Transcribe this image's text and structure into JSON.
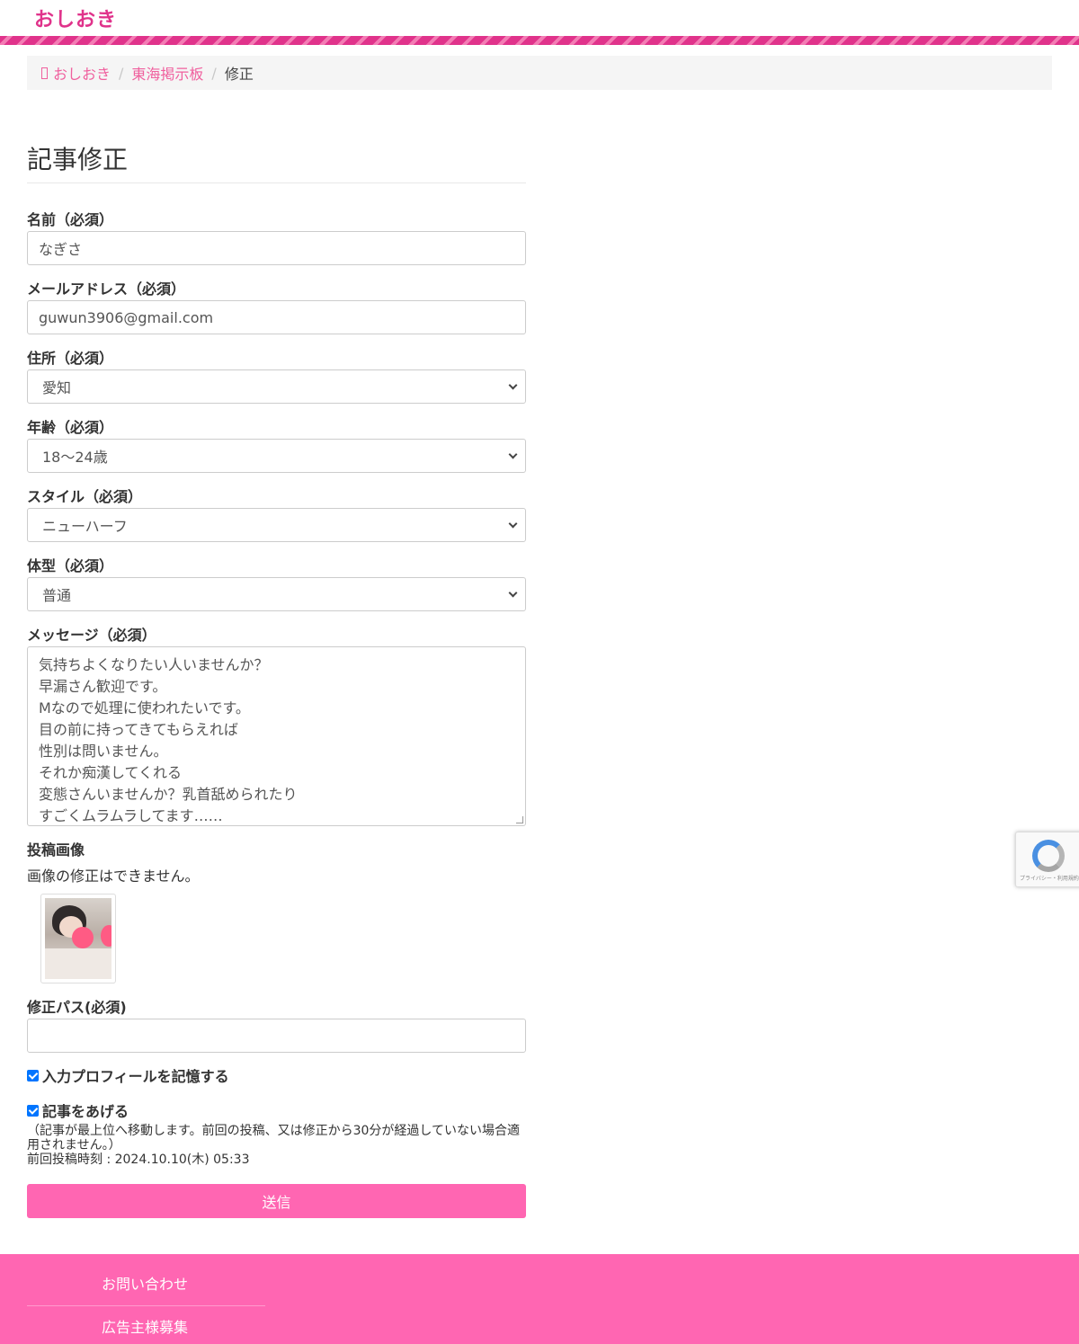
{
  "header": {
    "logo": "おしおき"
  },
  "breadcrumb": {
    "home": "おしおき",
    "board": "東海掲示板",
    "current": "修正"
  },
  "page_title": "記事修正",
  "form": {
    "name_label": "名前（必須）",
    "name_value": "なぎさ",
    "email_label": "メールアドレス（必須）",
    "email_value": "guwun3906@gmail.com",
    "address_label": "住所（必須）",
    "address_value": "愛知",
    "age_label": "年齢（必須）",
    "age_value": "18〜24歳",
    "style_label": "スタイル（必須）",
    "style_value": "ニューハーフ",
    "body_type_label": "体型（必須）",
    "body_type_value": "普通",
    "message_label": "メッセージ（必須）",
    "message_lines": [
      "気持ちよくなりたい人いませんか？",
      "早漏さん歓迎です。",
      "Mなので処理に使われたいです。",
      "目の前に持ってきてもらえれば",
      "性別は問いません。",
      "それか痴漢してくれる",
      "変態さんいませんか？乳首舐められたり",
      "すごくムラムラしてます……"
    ],
    "image_label": "投稿画像",
    "image_note": "画像の修正はできません。",
    "password_label": "修正パス(必須)",
    "password_value": "",
    "remember_label": "入力プロフィールを記憶する",
    "remember_checked": true,
    "bump_label": "記事をあげる",
    "bump_checked": true,
    "bump_note": "（記事が最上位へ移動します。前回の投稿、又は修正から30分が経過していない場合適用されません。）",
    "last_post": "前回投稿時刻 : 2024.10.10(木) 05:33",
    "submit_label": "送信"
  },
  "recaptcha": {
    "text": "プライバシー・利用規約"
  },
  "footer": {
    "links": [
      "お問い合わせ",
      "広告主様募集"
    ]
  },
  "colors": {
    "brand": "#e0338b",
    "link": "#f0609e",
    "button": "#ff66b2",
    "footer": "#ff66b2"
  }
}
